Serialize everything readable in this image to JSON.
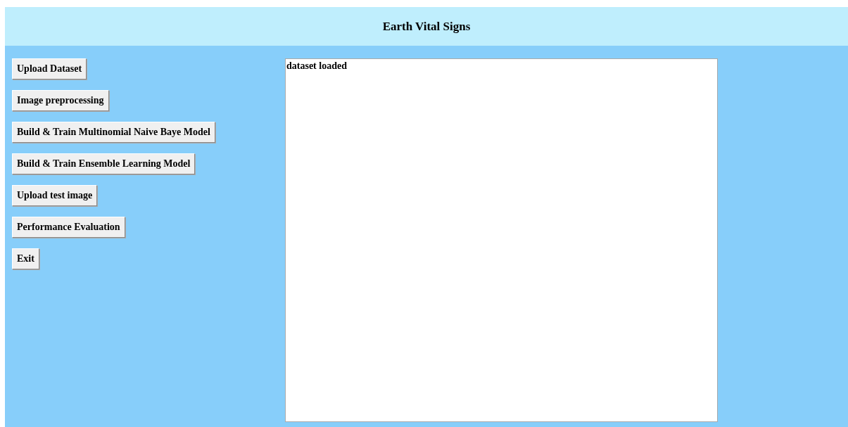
{
  "window": {
    "title": "Earth Vital Signs"
  },
  "buttons": [
    "Upload Dataset",
    "Image preprocessing",
    "Build & Train Multinomial Naive Baye Model",
    "Build & Train Ensemble Learning Model",
    "Upload test image",
    "Performance Evaluation",
    "Exit"
  ],
  "output": {
    "value": "dataset loaded\n"
  }
}
